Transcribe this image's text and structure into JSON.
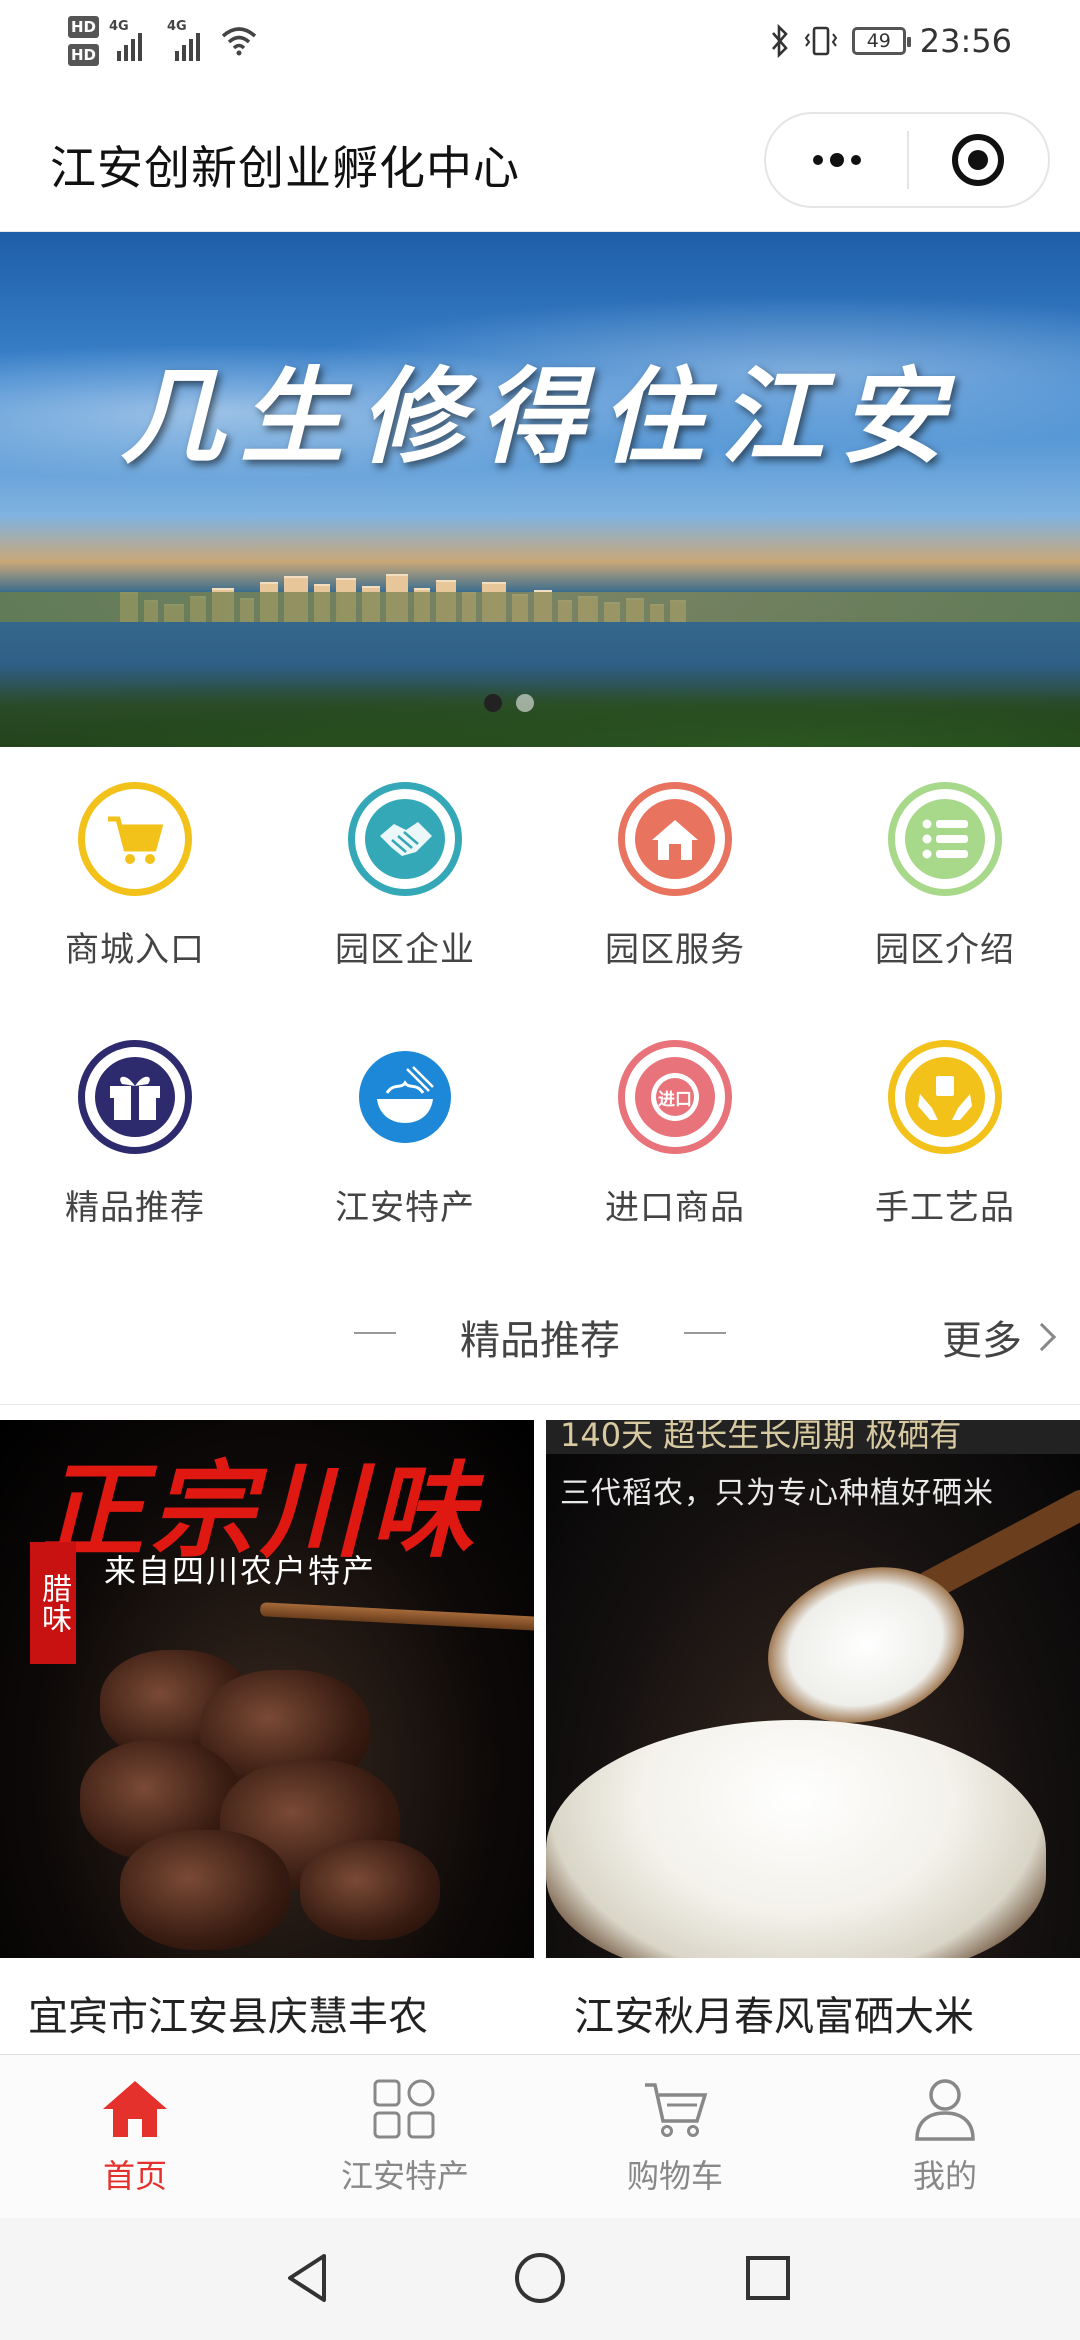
{
  "status_bar": {
    "hd1": "HD",
    "hd2": "HD",
    "signal1": "4G",
    "signal2": "4G",
    "battery": "49",
    "time": "23:56"
  },
  "header": {
    "title": "江安创新创业孵化中心"
  },
  "banner": {
    "slogan": "几生修得住江安",
    "dots": 2,
    "active_dot": 0
  },
  "grid": {
    "items": [
      {
        "label": "商城入口",
        "icon": "cart-icon",
        "color": "#f2c21b"
      },
      {
        "label": "园区企业",
        "icon": "handshake-icon",
        "color": "#35a8b8"
      },
      {
        "label": "园区服务",
        "icon": "home-icon",
        "color": "#e8735f"
      },
      {
        "label": "园区介绍",
        "icon": "list-icon",
        "color": "#a8d88a"
      },
      {
        "label": "精品推荐",
        "icon": "gift-icon",
        "color": "#2d2a6e"
      },
      {
        "label": "江安特产",
        "icon": "noodle-bowl-icon",
        "color": "#1e88d8"
      },
      {
        "label": "进口商品",
        "icon": "import-badge-icon",
        "color": "#e8737a"
      },
      {
        "label": "手工艺品",
        "icon": "handcraft-icon",
        "color": "#f2c21b"
      }
    ],
    "import_badge_text": "进口"
  },
  "section": {
    "title": "精品推荐",
    "more": "更多"
  },
  "products": [
    {
      "name": "宜宾市江安县庆慧丰农",
      "image_title": "正宗川味",
      "image_sub": "来自四川农户特产",
      "image_tag": "腊味"
    },
    {
      "name": "江安秋月春风富硒大米",
      "image_top": "140天 超长生长周期 极硒有",
      "image_sub": "三代稻农，只为专心种植好硒米"
    }
  ],
  "tabbar": {
    "items": [
      {
        "label": "首页",
        "icon": "home-icon",
        "active": true
      },
      {
        "label": "江安特产",
        "icon": "category-icon",
        "active": false
      },
      {
        "label": "购物车",
        "icon": "cart-icon",
        "active": false
      },
      {
        "label": "我的",
        "icon": "user-icon",
        "active": false
      }
    ],
    "active_color": "#e5312c",
    "inactive_color": "#888888"
  },
  "navbar": {
    "buttons": [
      "back-icon",
      "home-circle-icon",
      "recents-icon"
    ]
  }
}
